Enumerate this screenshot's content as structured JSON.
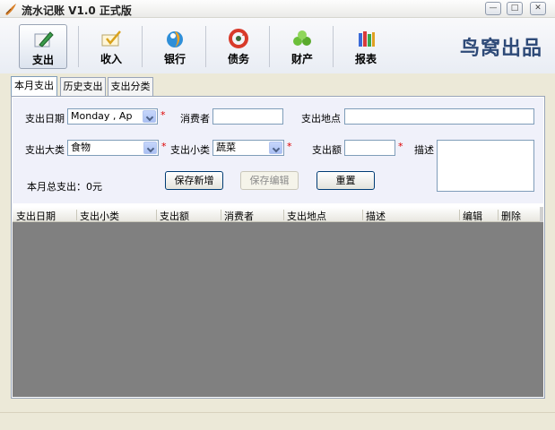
{
  "window": {
    "title": "流水记账  V1.0  正式版",
    "controls": {
      "minimize": "—",
      "maximize": "□",
      "close": "✕"
    }
  },
  "toolbar": {
    "items": [
      {
        "label": "支出",
        "icon": "pencil-paper-icon",
        "active": true
      },
      {
        "label": "收入",
        "icon": "envelope-check-icon",
        "active": false
      },
      {
        "label": "银行",
        "icon": "bank-swirl-icon",
        "active": false
      },
      {
        "label": "债务",
        "icon": "debt-cycle-icon",
        "active": false
      },
      {
        "label": "财产",
        "icon": "property-group-icon",
        "active": false
      },
      {
        "label": "报表",
        "icon": "report-books-icon",
        "active": false
      }
    ],
    "brand": "鸟窝出品"
  },
  "tabs": [
    {
      "label": "本月支出",
      "active": true
    },
    {
      "label": "历史支出",
      "active": false
    },
    {
      "label": "支出分类",
      "active": false
    }
  ],
  "form": {
    "date_label": "支出日期",
    "date_value": "Monday  ,   Ap",
    "consumer_label": "消费者",
    "consumer_value": "",
    "place_label": "支出地点",
    "place_value": "",
    "category_label": "支出大类",
    "category_value": "食物",
    "subcategory_label": "支出小类",
    "subcategory_value": "蔬菜",
    "amount_label": "支出额",
    "amount_value": "",
    "desc_label": "描述",
    "desc_value": "",
    "required_mark": "*",
    "total_label": "本月总支出：0元",
    "save_new": "保存新增",
    "save_edit": "保存编辑",
    "reset": "重置"
  },
  "grid": {
    "columns": [
      "支出日期",
      "支出小类",
      "支出额",
      "消费者",
      "支出地点",
      "描述",
      "编辑",
      "删除"
    ]
  },
  "colors": {
    "brand": "#2e4a78",
    "required": "#dd0000",
    "grid_bg": "#808080"
  }
}
